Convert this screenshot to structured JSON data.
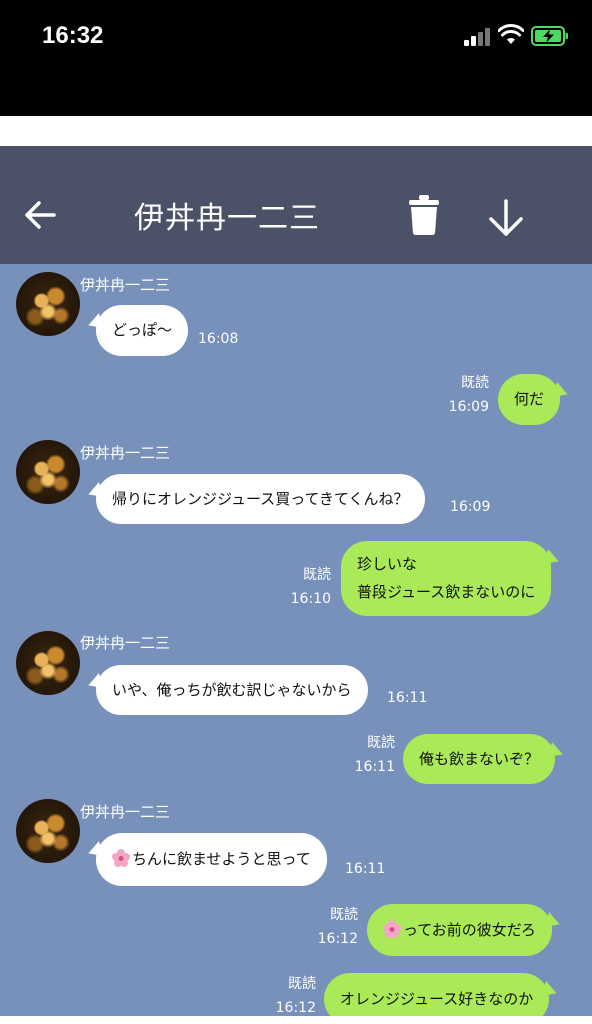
{
  "status_bar": {
    "time": "16:32"
  },
  "header": {
    "title": "伊丼冉一二三"
  },
  "contact": {
    "name": "伊丼冉一二三"
  },
  "read_label": "既読",
  "messages": [
    {
      "dir": "in",
      "text": "どっぽ〜",
      "time": "16:08"
    },
    {
      "dir": "out",
      "text": "何だ",
      "time": "16:09",
      "read": "既読"
    },
    {
      "dir": "in",
      "text": "帰りにオレンジジュース買ってきてくんね？",
      "time": "16:09"
    },
    {
      "dir": "out",
      "lines": [
        "珍しいな",
        "普段ジュース飲まないのに"
      ],
      "time": "16:10",
      "read": "既読"
    },
    {
      "dir": "in",
      "text": "いや、俺っちが飲む訳じゃないから",
      "time": "16:11"
    },
    {
      "dir": "out",
      "text": "俺も飲まないぞ？",
      "time": "16:11",
      "read": "既読"
    },
    {
      "dir": "in",
      "text": "ちんに飲ませようと思って",
      "time": "16:11",
      "emoji": "flower-emoji"
    },
    {
      "dir": "out",
      "text": "ってお前の彼女だろ",
      "time": "16:12",
      "read": "既読",
      "emoji": "flower-emoji"
    },
    {
      "dir": "out",
      "text": "オレンジジュース好きなのか",
      "time": "16:12",
      "read": "既読"
    }
  ],
  "icons": {
    "back": "arrow-left-icon",
    "trash": "trash-icon",
    "download": "arrow-down-icon"
  },
  "colors": {
    "header_bg": "#4b5166",
    "chat_bg": "#7891bb",
    "outgoing_bubble": "#aaea58",
    "incoming_bubble": "#ffffff"
  }
}
